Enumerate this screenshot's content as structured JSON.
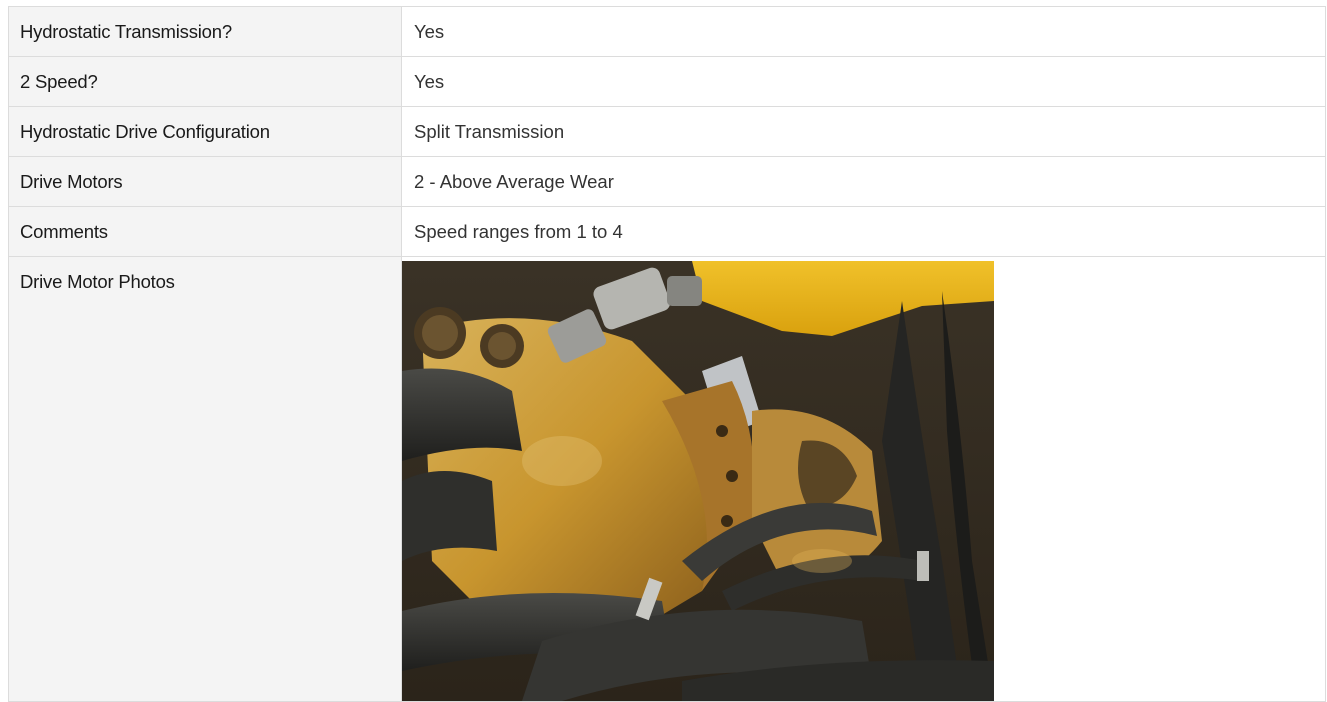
{
  "rows": [
    {
      "label": "Hydrostatic Transmission?",
      "value": "Yes"
    },
    {
      "label": "2 Speed?",
      "value": "Yes"
    },
    {
      "label": "Hydrostatic Drive Configuration",
      "value": "Split Transmission"
    },
    {
      "label": "Drive Motors",
      "value": "2 - Above Average Wear"
    },
    {
      "label": "Comments",
      "value": "Speed ranges from 1 to 4"
    }
  ],
  "photo_row": {
    "label": "Drive Motor Photos",
    "photo_subject": "drive-motor-photo",
    "colors": {
      "machine_yellow": "#d9a83a",
      "hose_black": "#2a2a28",
      "shadow": "#4a3a20",
      "metal_gray": "#9a9a98"
    }
  }
}
